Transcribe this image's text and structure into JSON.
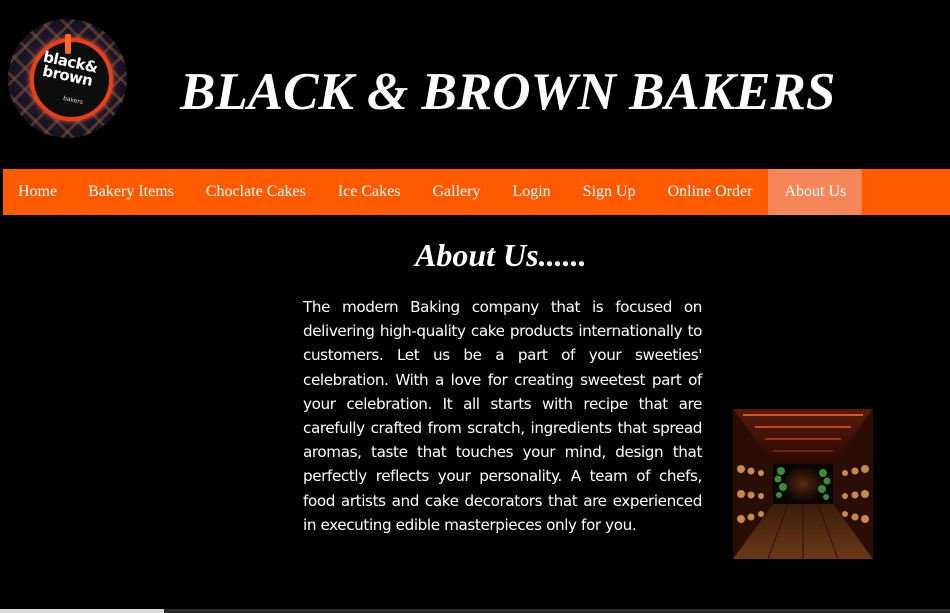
{
  "header": {
    "logo": {
      "text_line1": "black&",
      "text_line2": "brown",
      "subtext": "bakers",
      "accent_color": "#e8401c"
    },
    "title": "BLACK & BROWN BAKERS"
  },
  "nav": {
    "background_color": "#ff5a00",
    "active_color": "#f4865a",
    "items": [
      {
        "label": "Home",
        "active": false
      },
      {
        "label": "Bakery Items",
        "active": false
      },
      {
        "label": "Choclate Cakes",
        "active": false
      },
      {
        "label": "Ice Cakes",
        "active": false
      },
      {
        "label": "Gallery",
        "active": false
      },
      {
        "label": "Login",
        "active": false
      },
      {
        "label": "Sign Up",
        "active": false
      },
      {
        "label": "Online Order",
        "active": false
      },
      {
        "label": "About Us",
        "active": true
      }
    ]
  },
  "main": {
    "heading": "About Us......",
    "paragraph": "The modern Baking company that is focused on delivering high-quality cake products internationally to customers. Let us be a part of your sweeties' celebration. With a love for creating sweetest part of your celebration. It all starts with recipe that are carefully crafted from scratch, ingredients that spread aromas, taste that touches your mind, design that perfectly reflects your personality. A team of chefs, food artists and cake decorators that are experienced in executing edible masterpieces only for you.",
    "image_icon": "bakery-interior-photo"
  },
  "colors": {
    "page_background": "#000000",
    "text": "#ffffff"
  }
}
